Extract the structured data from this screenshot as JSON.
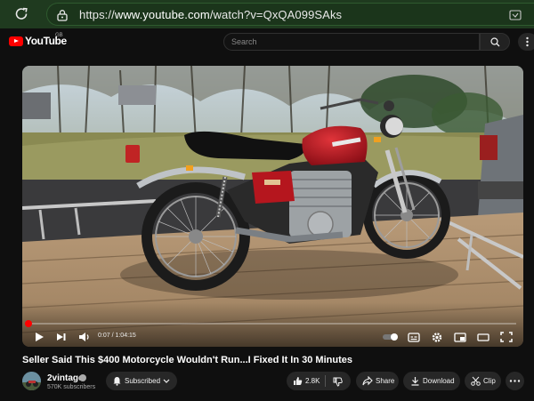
{
  "browser": {
    "url_prefix": "https://",
    "url_host": "www.youtube.com",
    "url_path": "/watch?v=QxQA099SAks"
  },
  "header": {
    "logo_text": "YouTube",
    "country_code": "GB",
    "search_placeholder": "Search"
  },
  "player": {
    "time_current": "0:07",
    "time_separator": " / ",
    "time_total": "1:04:15",
    "progress_fraction": 0.0018
  },
  "video": {
    "title": "Seller Said This $400 Motorcycle Wouldn't Run...I Fixed It In 30 Minutes"
  },
  "channel": {
    "name": "2vintage",
    "subscribers": "570K subscribers"
  },
  "actions": {
    "subscribed_label": "Subscribed",
    "likes": "2.8K",
    "share_label": "Share",
    "download_label": "Download",
    "clip_label": "Clip"
  },
  "colors": {
    "accent": "#ff0000",
    "browser_chrome": "#1f3a1f",
    "background": "#0f0f0f"
  }
}
